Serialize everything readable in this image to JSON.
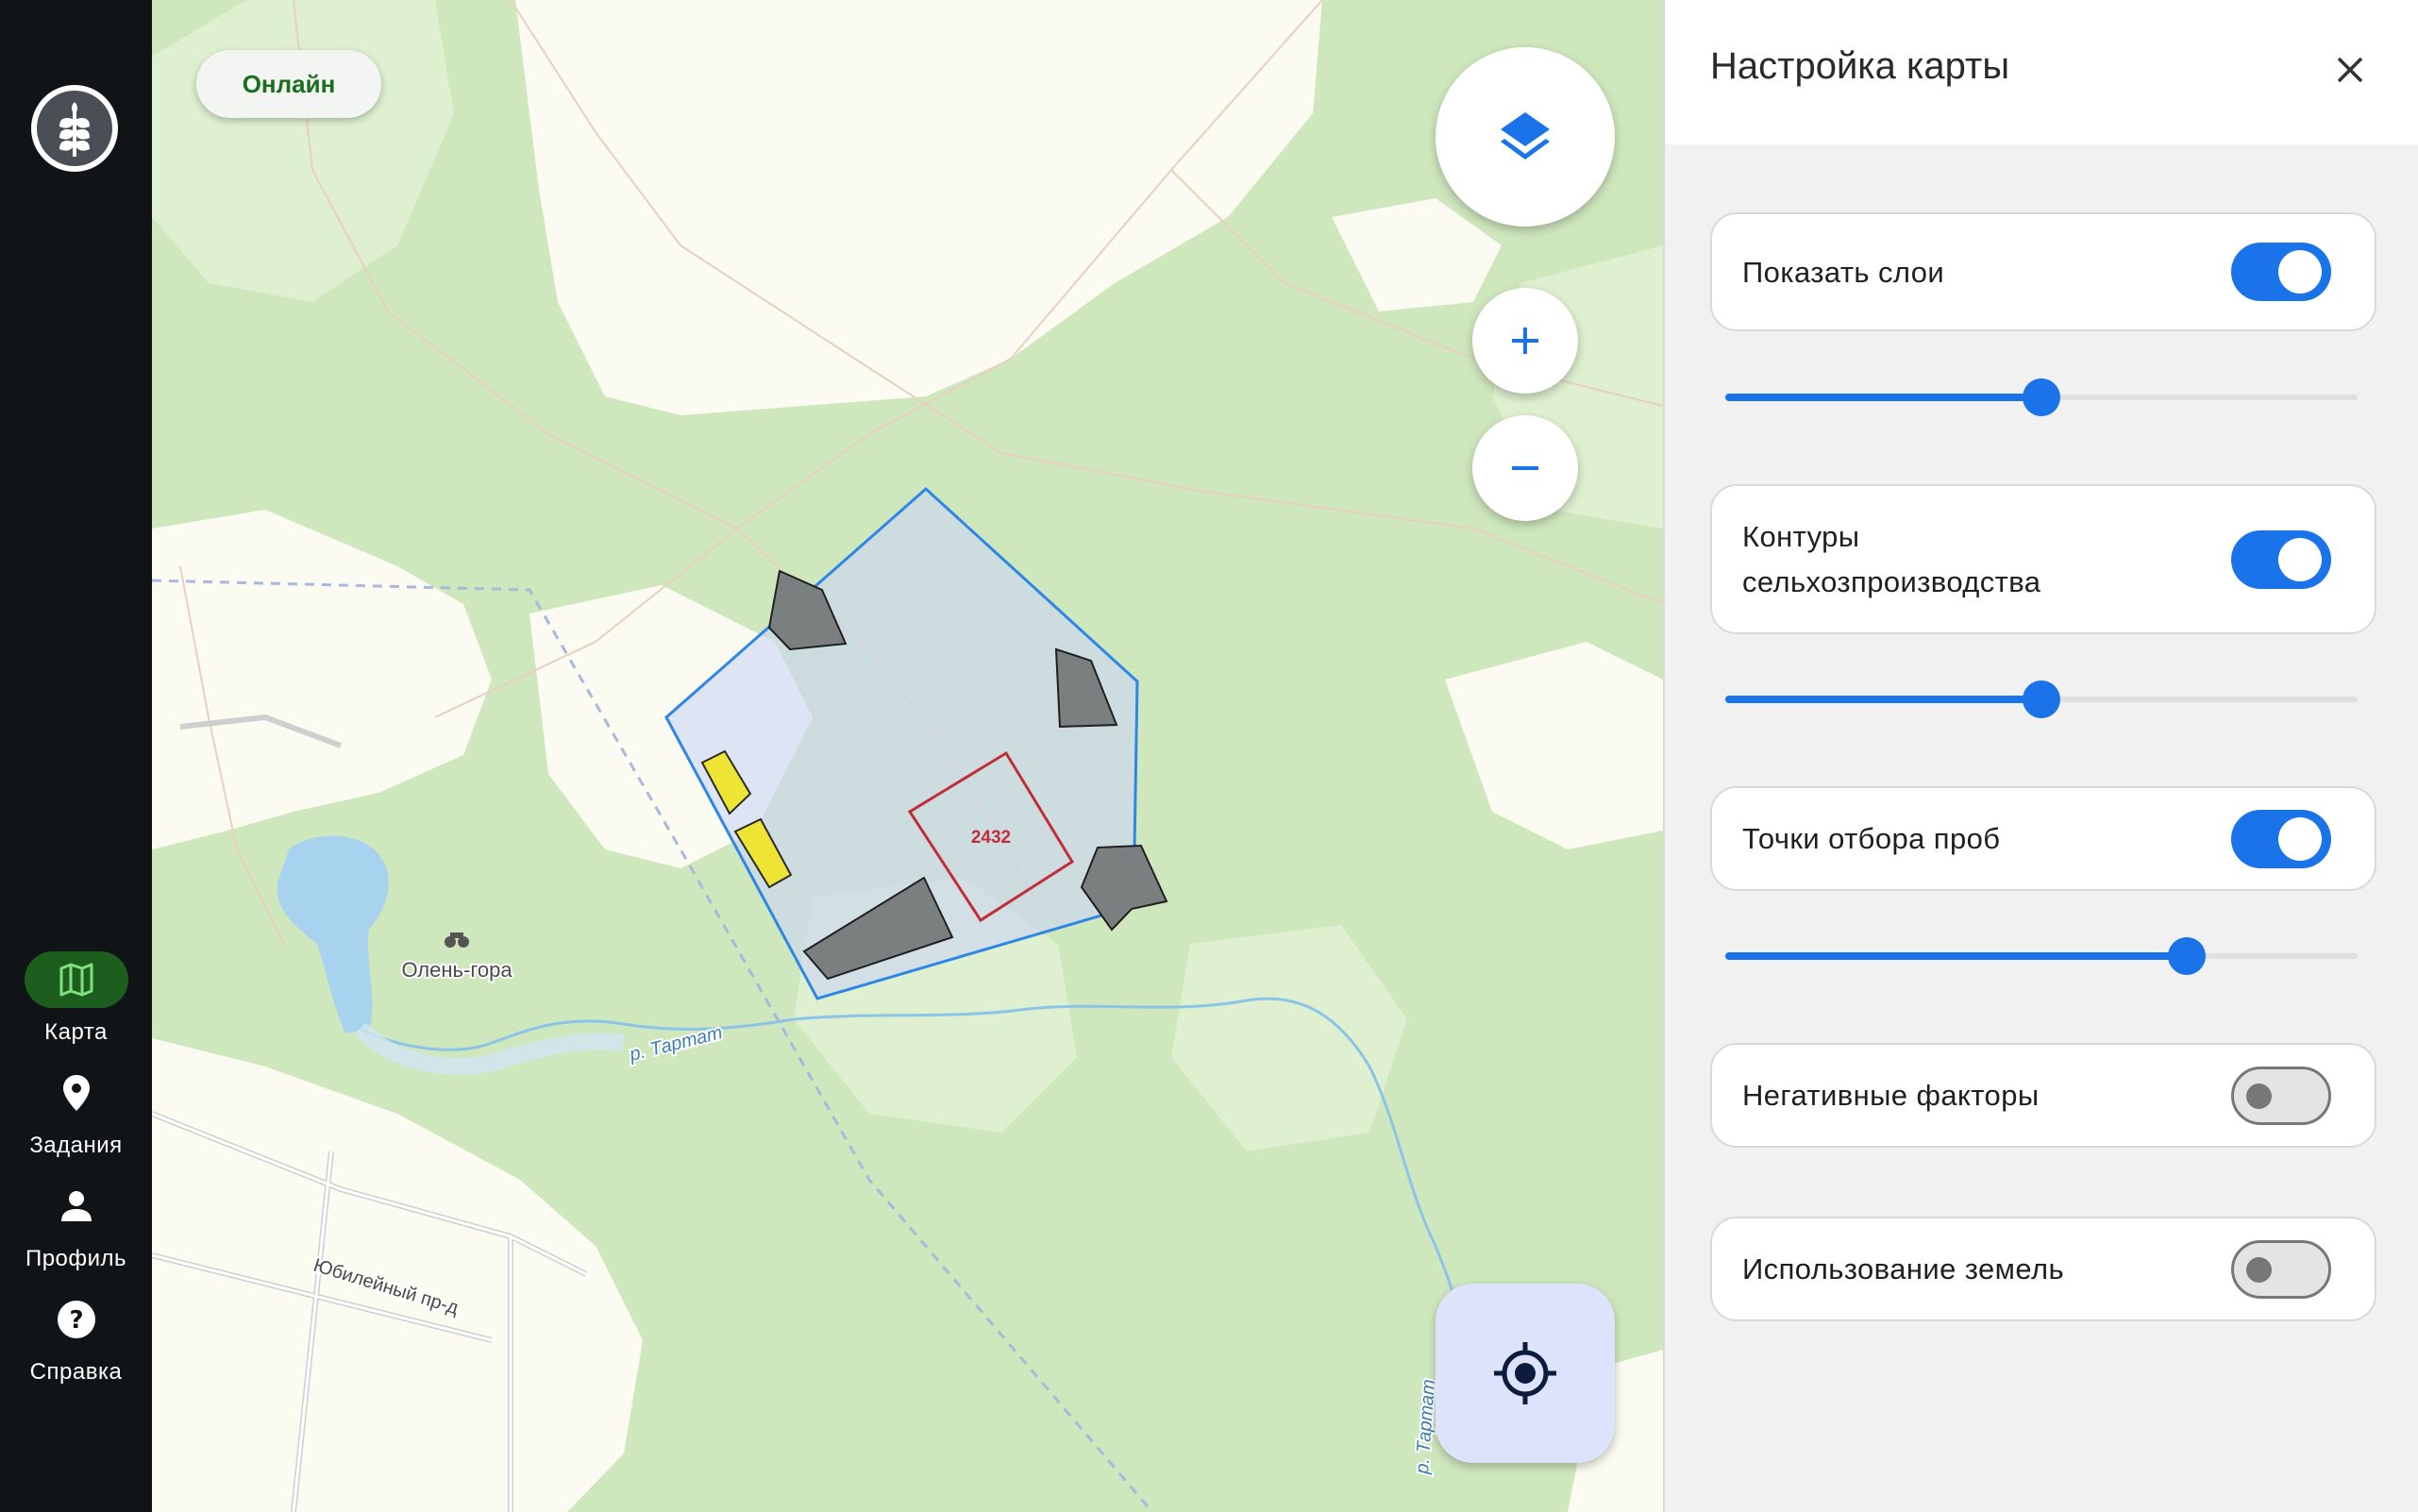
{
  "nav": {
    "logo": "wheat-logo",
    "items": [
      {
        "label": "Карта",
        "icon": "map-icon",
        "active": true
      },
      {
        "label": "Задания",
        "icon": "location-pin-icon",
        "active": false
      },
      {
        "label": "Профиль",
        "icon": "person-icon",
        "active": false
      },
      {
        "label": "Справка",
        "icon": "help-icon",
        "active": false
      }
    ]
  },
  "map": {
    "status": "Онлайн",
    "field_label": "2432",
    "place_label": "Олень-гора",
    "river_label": "р. Тартат",
    "river_label_2": "р. Тартат",
    "street_label": "Юбилейный пр-д",
    "controls": {
      "layers": "layers-icon",
      "zoom_in": "+",
      "zoom_out": "−",
      "locate": "my-location-icon"
    }
  },
  "panel": {
    "title": "Настройка карты",
    "close": "close-icon",
    "layers": [
      {
        "label": "Показать слои",
        "enabled": true,
        "opacity": 0.5
      },
      {
        "label_line1": "Контуры",
        "label_line2": "сельхозпроизводства",
        "enabled": true,
        "opacity": 0.5
      },
      {
        "label": "Точки отбора проб",
        "enabled": true,
        "opacity": 0.73
      },
      {
        "label": "Негативные факторы",
        "enabled": false
      },
      {
        "label": "Использование земель",
        "enabled": false
      }
    ]
  },
  "colors": {
    "accent": "#1a73e8",
    "rail": "#111417",
    "active_nav": "#1d5e1f",
    "online": "#1b6e1e",
    "forest": "#cfe7bd",
    "open_land": "#fbfbf1"
  }
}
